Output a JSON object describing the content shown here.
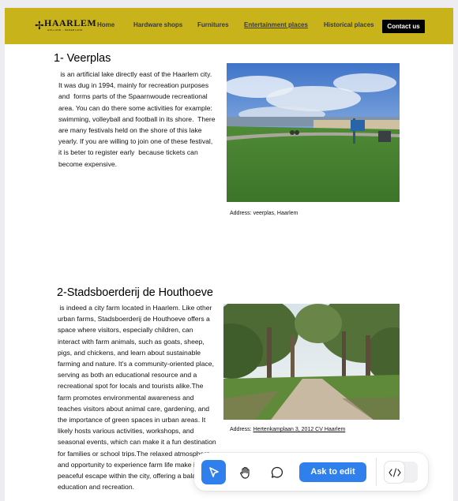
{
  "nav": {
    "logo_text": "HAARLEM",
    "logo_sub": "HOLLAND · NEDERLAND",
    "links": [
      "Home",
      "Hardware shops",
      "Furnitures",
      "Entertainment places",
      "Historical places"
    ],
    "active_link": "Entertainment places",
    "contact": "Contact us",
    "bar_color": "#c8b41a"
  },
  "sections": [
    {
      "title": "1- Veerplas",
      "lines": [
        " is an artificial lake directly east of the Haarlem city.",
        "It was dug in 1994, mainly for recreation purposes",
        "and  forms parts of the Spaarnwoude recreational",
        "area. You can do there some activities for example:",
        "swimming, volleyball and football in its shore.  There",
        "are many festivals held on the shore of this lake",
        "yearly. If you are willing to join one of these festival,",
        "it is beter to register early  because tickets can",
        "become expensive."
      ],
      "address_label": "Address: veerplas, Haarlem",
      "image_icon": "lake-shore-photo"
    },
    {
      "title": "2-Stadsboerderij de Houthoeve",
      "lines": [
        " is indeed a city farm located in Haarlem. Like other",
        "urban farms, Stadsboerderij de Houthoeve offers a",
        "space where visitors, especially children, can",
        "interact with farm animals, such as goats, sheep,",
        "pigs, and chickens, and learn about sustainable",
        "farming and nature. It's a community-oriented place,",
        "serving as both an educational resource and a",
        "recreational spot for locals and tourists alike.The",
        "farm promotes environmental awareness and",
        "teaches visitors about animal care, gardening, and",
        "the importance of green spaces in urban areas. It",
        "likely hosts various activities, workshops, and",
        "seasonal events, which can make it a fun destination",
        "for families or school trips.The relaxed atmosphere",
        "and opportunity to experience farm life make it a",
        "peaceful escape within the city, offering a balance of",
        "education and recreation."
      ],
      "address_prefix": "Address: ",
      "address_link": "Hertenkamplaan 3, 2012 CV Haarlem",
      "image_icon": "park-path-photo"
    }
  ],
  "toolbar": {
    "ask_label": "Ask to edit",
    "tools": [
      "cursor-icon",
      "hand-icon",
      "comment-icon",
      "code-icon"
    ],
    "accent": "#2f80ed"
  }
}
